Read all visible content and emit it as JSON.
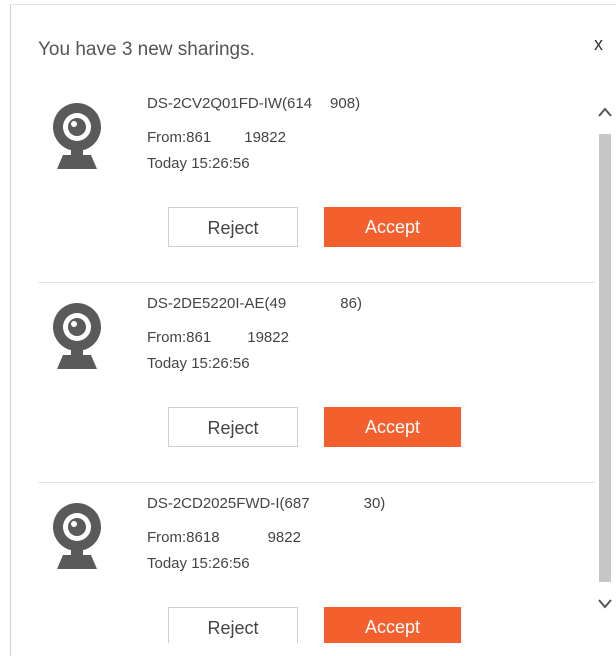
{
  "dialog": {
    "title": "You have 3 new sharings.",
    "close_label": "x"
  },
  "sharings": [
    {
      "device": "DS-2CV2Q01FD-IW(614      908)",
      "from": "From:861           19822",
      "time": "Today 15:26:56",
      "reject_label": "Reject",
      "accept_label": "Accept"
    },
    {
      "device": "DS-2DE5220I-AE(49                  86)",
      "from": "From:861            19822",
      "time": "Today 15:26:56",
      "reject_label": "Reject",
      "accept_label": "Accept"
    },
    {
      "device": "DS-2CD2025FWD-I(687                  30)",
      "from": "From:8618                9822",
      "time": "Today 15:26:56",
      "reject_label": "Reject",
      "accept_label": "Accept"
    }
  ],
  "icons": {
    "device": "webcam-icon",
    "close": "close-icon",
    "scroll_up": "chevron-up-icon",
    "scroll_down": "chevron-down-icon"
  },
  "colors": {
    "accent": "#f4602d",
    "icon": "#5a5a5a",
    "text": "#444444"
  }
}
